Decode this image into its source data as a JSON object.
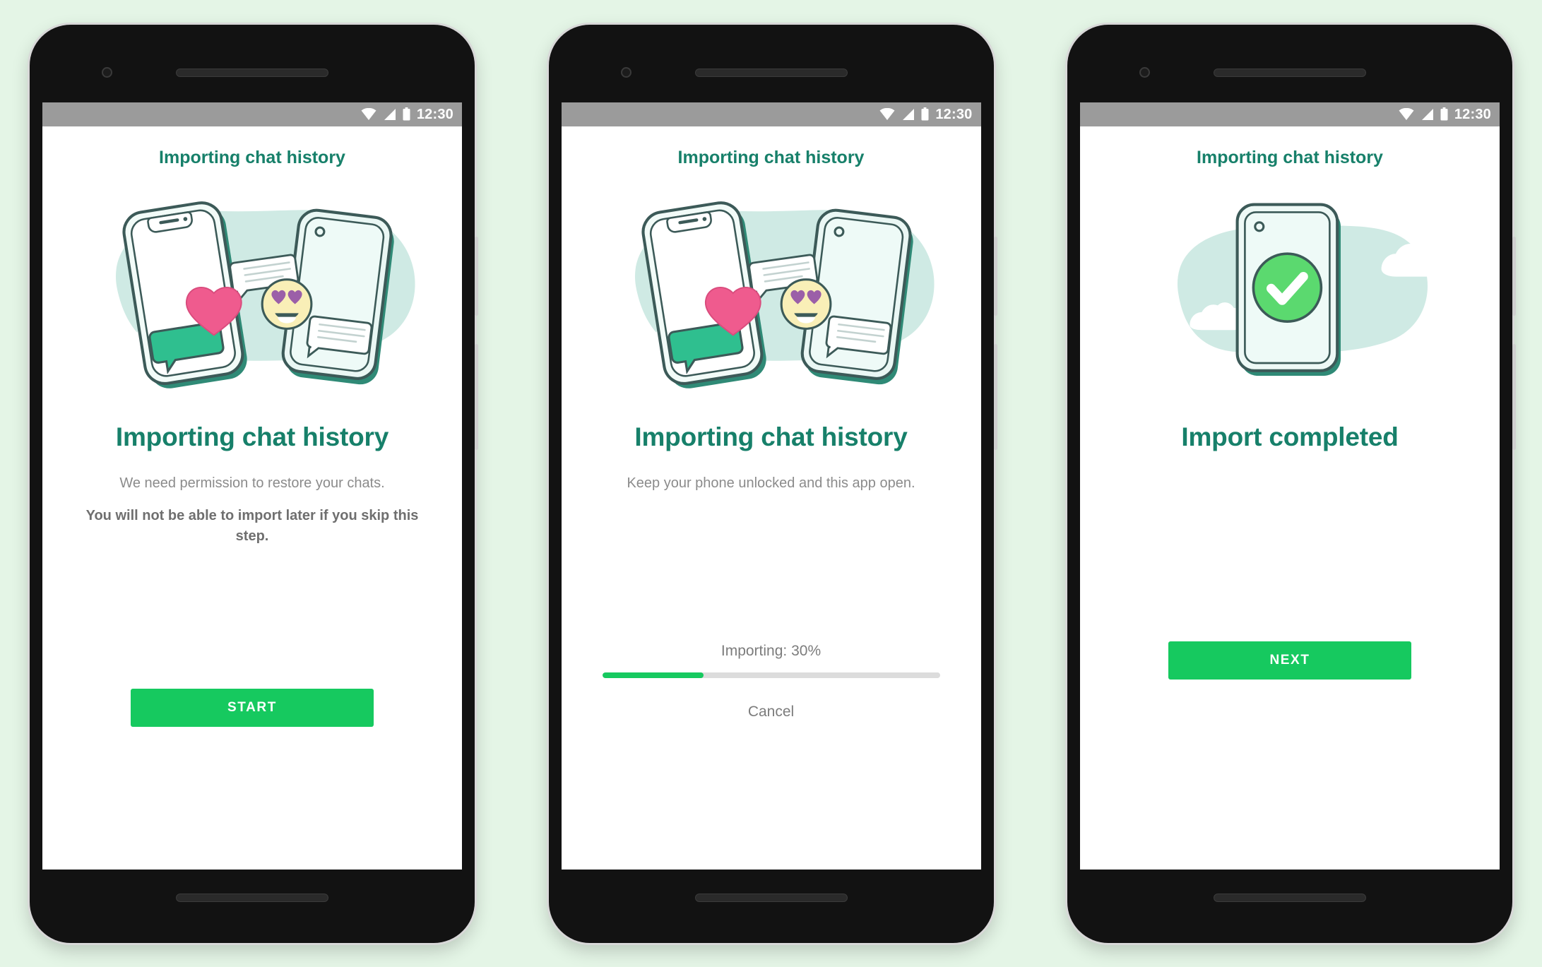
{
  "theme": {
    "page_background": "#e4f5e6",
    "brand_teal": "#17806a",
    "accent_green": "#16c95f",
    "status_bar_gray": "#9b9b9b",
    "muted_text": "#8b8b8b",
    "track_gray": "#dcdcdc"
  },
  "status_bar": {
    "time": "12:30",
    "icons": [
      "wifi-icon",
      "cellular-signal-icon",
      "battery-icon"
    ]
  },
  "screens": [
    {
      "id": "permission",
      "app_title": "Importing chat history",
      "illustration": "two-phones-chat-transfer-illustration",
      "headline": "Importing chat history",
      "subtitle": "We need permission to restore your chats.",
      "warning": "You will not be able to import later if you skip this step.",
      "primary_button": "START"
    },
    {
      "id": "progress",
      "app_title": "Importing chat history",
      "illustration": "two-phones-chat-transfer-illustration",
      "headline": "Importing chat history",
      "subtitle": "Keep your phone unlocked and this app open.",
      "progress_label": "Importing: 30%",
      "progress_percent": 30,
      "cancel_label": "Cancel"
    },
    {
      "id": "completed",
      "app_title": "Importing chat history",
      "illustration": "phone-with-green-checkmark-illustration",
      "headline": "Import completed",
      "primary_button": "NEXT"
    }
  ]
}
